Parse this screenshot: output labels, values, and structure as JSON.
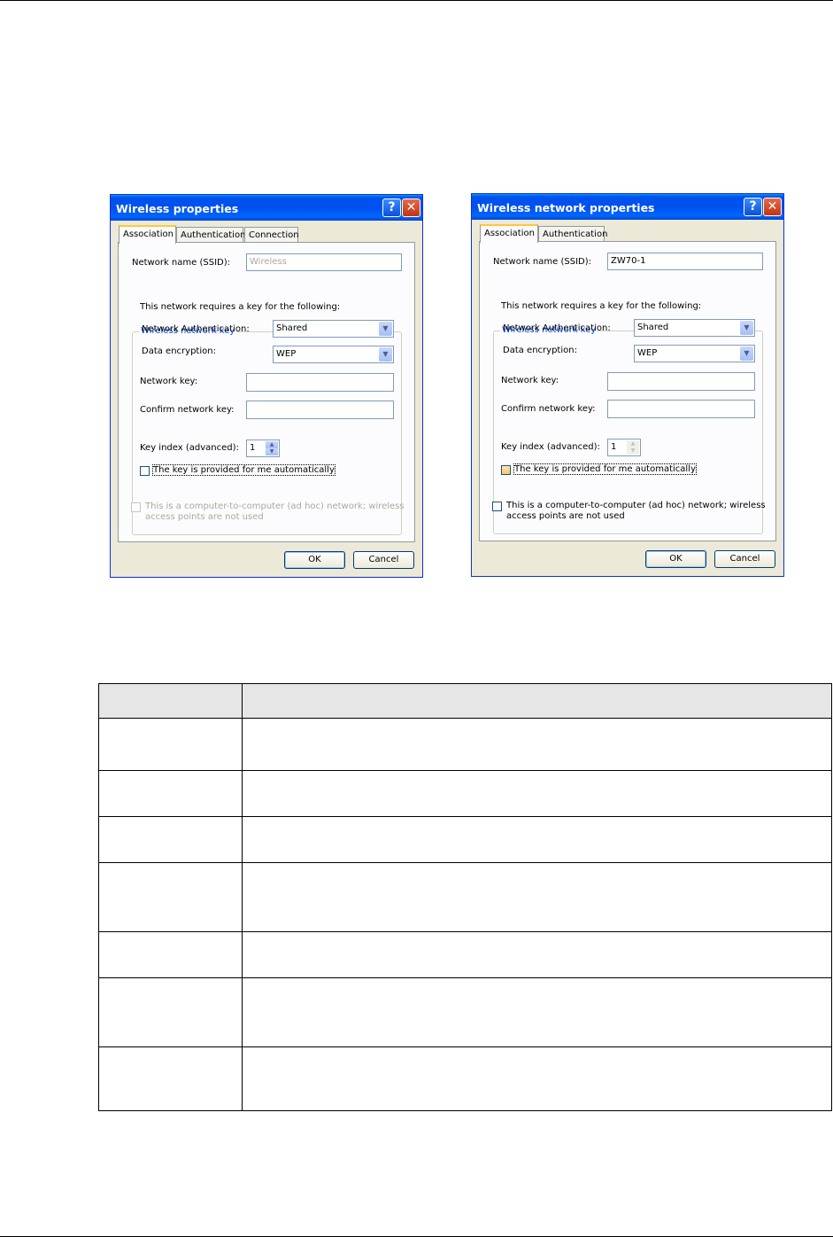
{
  "dialog1": {
    "title": "Wireless properties",
    "tabs": [
      "Association",
      "Authentication",
      "Connection"
    ],
    "ssid_label": "Network name (SSID):",
    "ssid_value": "Wireless",
    "group_title": "Wireless network key",
    "requires_text": "This network requires a key for the following:",
    "auth_label": "Network Authentication:",
    "auth_value": "Shared",
    "enc_label": "Data encryption:",
    "enc_value": "WEP",
    "key_label": "Network key:",
    "confirm_label": "Confirm network key:",
    "index_label": "Key index (advanced):",
    "index_value": "1",
    "auto_key_text": "The key is provided for me automatically",
    "adhoc_line1": "This is a computer-to-computer (ad hoc) network; wireless",
    "adhoc_line2": "access points are not used",
    "ok_label": "OK",
    "cancel_label": "Cancel"
  },
  "dialog2": {
    "title": "Wireless network properties",
    "tabs": [
      "Association",
      "Authentication"
    ],
    "ssid_label": "Network name (SSID):",
    "ssid_value": "ZW70-1",
    "group_title": "Wireless network key",
    "requires_text": "This network requires a key for the following:",
    "auth_label": "Network Authentication:",
    "auth_value": "Shared",
    "enc_label": "Data encryption:",
    "enc_value": "WEP",
    "key_label": "Network key:",
    "confirm_label": "Confirm network key:",
    "index_label": "Key index (advanced):",
    "index_value": "1",
    "auto_key_text": "The key is provided for me automatically",
    "adhoc_line1": "This is a computer-to-computer (ad hoc) network; wireless",
    "adhoc_line2": "access points are not used",
    "ok_label": "OK",
    "cancel_label": "Cancel"
  },
  "colors": {
    "titlebar": "#0053ee",
    "dialog_bg": "#ece9d8",
    "group_title": "#0046d5",
    "table_header_bg": "#e6e6e6"
  },
  "table": {
    "header": [
      "",
      ""
    ],
    "rows": [
      [
        "",
        ""
      ],
      [
        "",
        ""
      ],
      [
        "",
        ""
      ],
      [
        "",
        ""
      ],
      [
        "",
        ""
      ],
      [
        "",
        ""
      ],
      [
        "",
        ""
      ]
    ]
  }
}
